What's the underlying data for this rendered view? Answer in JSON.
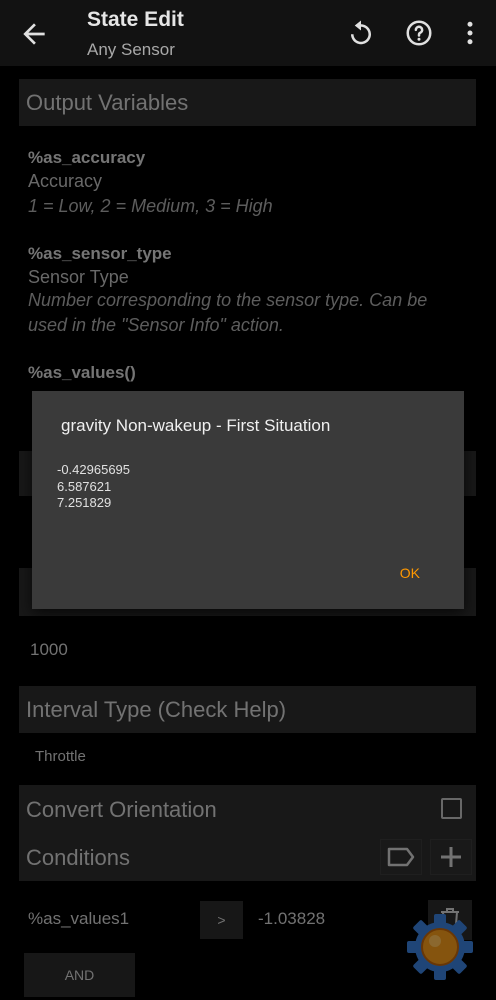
{
  "appbar": {
    "title": "State Edit",
    "subtitle": "Any Sensor",
    "icons": [
      "arrow-back-icon",
      "undo-icon",
      "help-icon",
      "more-vert-icon"
    ]
  },
  "sections": {
    "output_variables": "Output Variables",
    "interval_type": "Interval Type (Check Help)",
    "convert_orientation": "Convert Orientation",
    "conditions": "Conditions"
  },
  "variables": [
    {
      "name": "%as_accuracy",
      "title": "Accuracy",
      "desc": "1 = Low, 2 = Medium, 3 = High"
    },
    {
      "name": "%as_sensor_type",
      "title": "Sensor Type",
      "desc": "Number corresponding to the sensor type. Can be used in the \"Sensor Info\" action."
    },
    {
      "name": "%as_values()"
    }
  ],
  "interval": {
    "value": "1000"
  },
  "interval_type": {
    "value": "Throttle"
  },
  "condition": {
    "variable": "%as_values1",
    "operator": ">",
    "value": "-1.03828",
    "and_label": "AND"
  },
  "dialog": {
    "title": "gravity  Non-wakeup - First Situation",
    "lines": [
      "-0.42965695",
      "6.587621",
      "7.251829"
    ],
    "ok_label": "OK"
  },
  "colors": {
    "accent": "#ff9800",
    "section_bg": "#2d2d2d",
    "dialog_bg": "#3a3a3a"
  }
}
